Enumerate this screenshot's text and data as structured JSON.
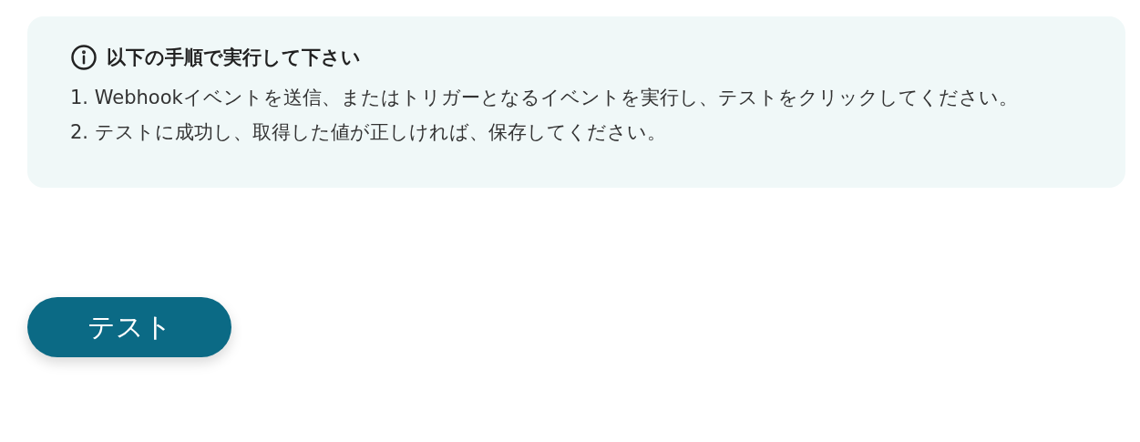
{
  "notice": {
    "title": "以下の手順で実行して下さい",
    "steps": [
      "1. Webhookイベントを送信、またはトリガーとなるイベントを実行し、テストをクリックしてください。",
      "2. テストに成功し、取得した値が正しければ、保存してください。"
    ]
  },
  "test_button": {
    "label": "テスト"
  }
}
